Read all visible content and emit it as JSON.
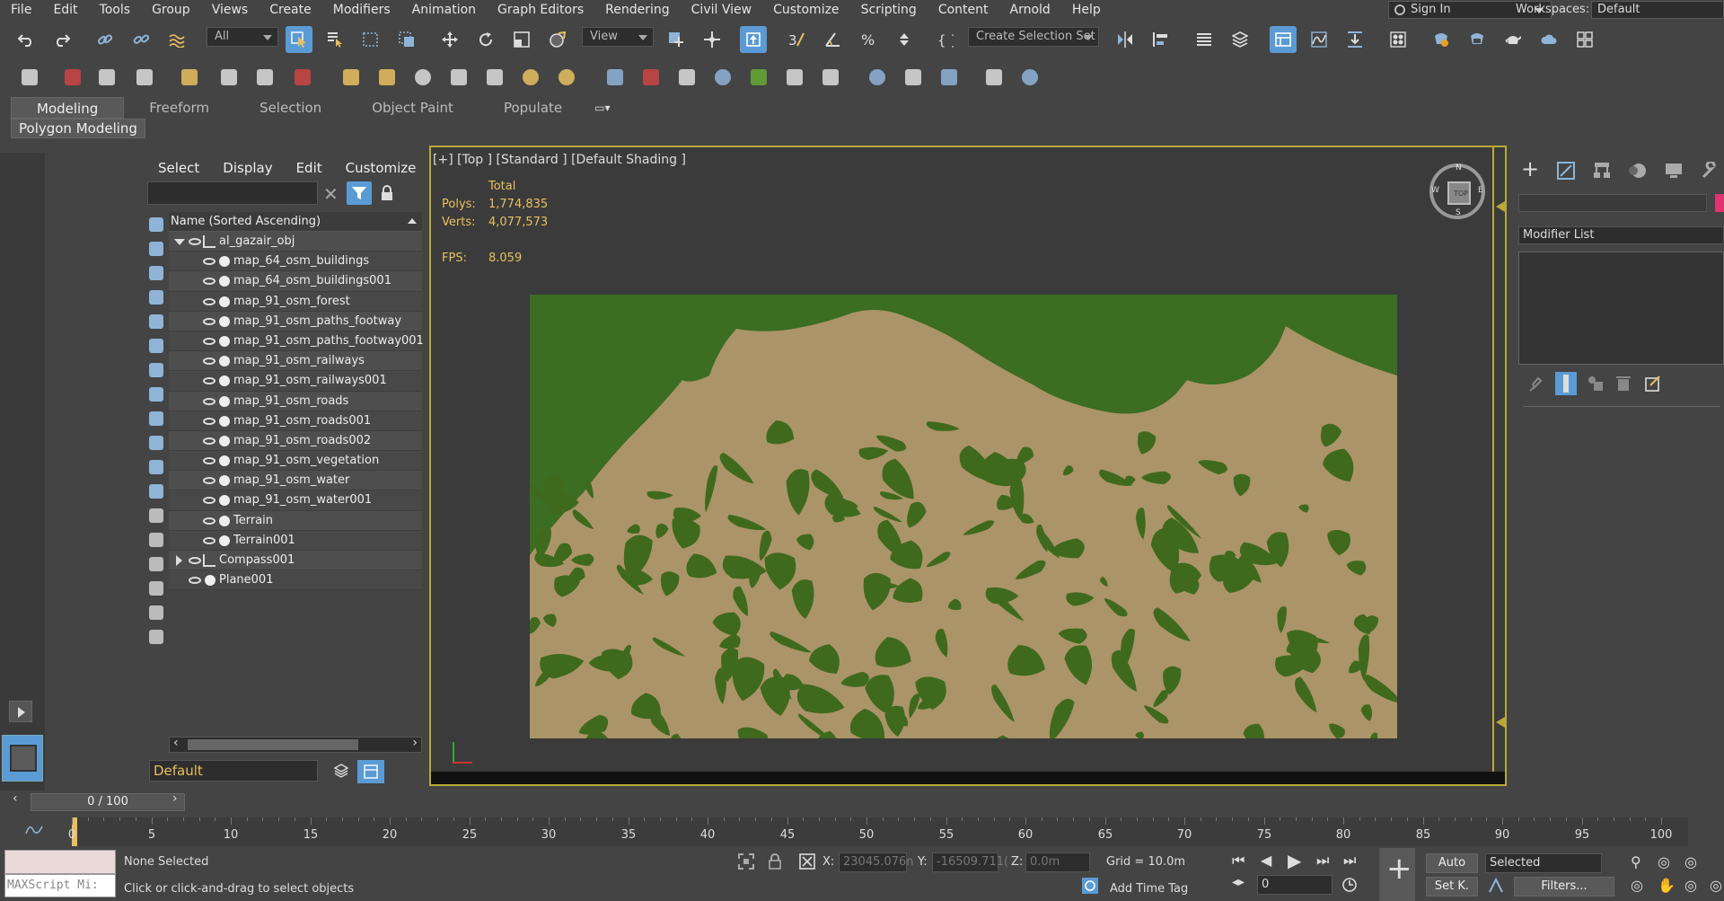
{
  "menu": [
    "File",
    "Edit",
    "Tools",
    "Group",
    "Views",
    "Create",
    "Modifiers",
    "Animation",
    "Graph Editors",
    "Rendering",
    "Civil View",
    "Customize",
    "Scripting",
    "Content",
    "Arnold",
    "Help"
  ],
  "account": {
    "sign_in": "Sign In"
  },
  "workspace": {
    "label": "Workspaces:",
    "value": "Default"
  },
  "toolbar": {
    "filter_value": "All",
    "view_value": "View",
    "selection_set_placeholder": "Create Selection Set"
  },
  "ribbon": {
    "tabs": [
      "Modeling",
      "Freeform",
      "Selection",
      "Object Paint",
      "Populate"
    ],
    "active_tab": "Modeling",
    "subpanel": "Polygon Modeling"
  },
  "scene_explorer": {
    "menu": [
      "Select",
      "Display",
      "Edit",
      "Customize"
    ],
    "column_header": "Name (Sorted Ascending)",
    "root": "al_gazair_obj",
    "children": [
      "map_64_osm_buildings",
      "map_64_osm_buildings001",
      "map_91_osm_forest",
      "map_91_osm_paths_footway",
      "map_91_osm_paths_footway001",
      "map_91_osm_railways",
      "map_91_osm_railways001",
      "map_91_osm_roads",
      "map_91_osm_roads001",
      "map_91_osm_roads002",
      "map_91_osm_vegetation",
      "map_91_osm_water",
      "map_91_osm_water001",
      "Terrain",
      "Terrain001"
    ],
    "top_level": [
      "Compass001",
      "Plane001"
    ],
    "layer": "Default"
  },
  "viewport": {
    "label": "[+] [Top ] [Standard ] [Default Shading ]",
    "stats_header": "Total",
    "polys_label": "Polys:",
    "polys": "1,774,835",
    "verts_label": "Verts:",
    "verts": "4,077,573",
    "fps_label": "FPS:",
    "fps": "8.059",
    "compass": {
      "n": "N",
      "s": "S",
      "e": "E",
      "w": "W",
      "cube": "TOP"
    },
    "colors": {
      "land": "#ab9468",
      "vegetation": "#3f6a1e",
      "sea": "#3b6d22",
      "frame": "#bba83a"
    }
  },
  "command_panel": {
    "modifier_list": "Modifier List"
  },
  "timeline": {
    "frame_display": "0 / 100",
    "tick_labels": [
      "0",
      "5",
      "10",
      "15",
      "20",
      "25",
      "30",
      "35",
      "40",
      "45",
      "50",
      "55",
      "60",
      "65",
      "70",
      "75",
      "80",
      "85",
      "90",
      "95",
      "100"
    ]
  },
  "status": {
    "selection": "None Selected",
    "prompt": "Click or click-and-drag to select objects",
    "maxscript": "MAXScript Mi:",
    "x_label": "X:",
    "x": "23045.076n",
    "y_label": "Y:",
    "y": "-16509.711(",
    "z_label": "Z:",
    "z": "0.0m",
    "grid": "Grid = 10.0m",
    "add_time_tag": "Add Time Tag",
    "auto_key": "Auto",
    "set_key": "Set K.",
    "key_filter": "Selected",
    "filters": "Filters...",
    "current_frame": "0"
  }
}
